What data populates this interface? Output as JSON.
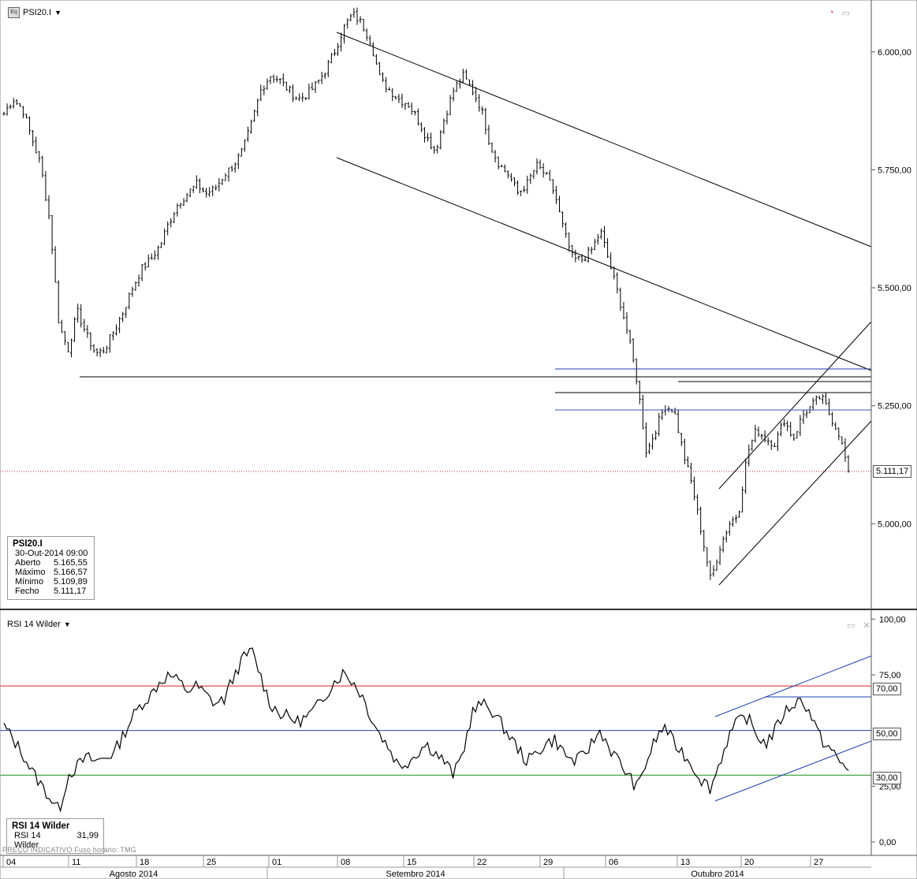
{
  "price_panel": {
    "symbol": "PSI20.I",
    "info": {
      "title": "PSI20.I",
      "datetime": "30-Out-2014 09:00",
      "rows": [
        {
          "label": "Aberto",
          "value": "5.165,55"
        },
        {
          "label": "Máximo",
          "value": "5.166,57"
        },
        {
          "label": "Mínimo",
          "value": "5.109,89"
        },
        {
          "label": "Fecho",
          "value": "5.111,17"
        }
      ]
    },
    "last_price_label": "5.111,17"
  },
  "rsi_panel": {
    "title": "RSI 14 Wilder",
    "info": {
      "title": "RSI 14 Wilder",
      "label": "RSI 14 Wilder",
      "value": "31,99"
    },
    "level_labels": [
      "70,00",
      "50,00",
      "30,00"
    ]
  },
  "footnote": "PREÇO INDICATIVO   Fuso horário: TMG",
  "colors": {
    "bars": "#000000",
    "trendlines": "#000000",
    "blue_lines": "#1f3fae",
    "rsi_line": "#000000",
    "rsi_70": "#e02020",
    "rsi_50": "#2a3fb0",
    "rsi_30": "#1a8a1a",
    "last_price_line": "#c03030",
    "axis_bg": "#ffffff",
    "grid_border": "#888888"
  },
  "chart_data": [
    {
      "type": "ohlc",
      "title": "PSI20.I",
      "y_ticks": [
        "6.000,00",
        "5.750,00",
        "5.500,00",
        "5.250,00",
        "5.000,00"
      ],
      "y_tick_values": [
        6000,
        5750,
        5500,
        5250,
        5000
      ],
      "ylim": [
        4820,
        6110
      ],
      "x_day_ticks": [
        "04",
        "11",
        "18",
        "25",
        "01",
        "08",
        "15",
        "22",
        "29",
        "06",
        "13",
        "20",
        "27"
      ],
      "x_months": [
        "Agosto 2014",
        "Setembro 2014",
        "Outubro 2014"
      ],
      "last_close": 5111.17,
      "closes": [
        5870,
        5900,
        5880,
        5820,
        5760,
        5640,
        5420,
        5370,
        5450,
        5400,
        5360,
        5370,
        5410,
        5450,
        5500,
        5540,
        5560,
        5590,
        5640,
        5680,
        5700,
        5720,
        5700,
        5710,
        5740,
        5760,
        5790,
        5850,
        5920,
        5950,
        5940,
        5920,
        5900,
        5910,
        5930,
        5960,
        6000,
        6050,
        6080,
        6060,
        6020,
        5940,
        5920,
        5900,
        5890,
        5860,
        5820,
        5790,
        5860,
        5920,
        5950,
        5920,
        5880,
        5800,
        5760,
        5740,
        5700,
        5720,
        5760,
        5740,
        5700,
        5620,
        5560,
        5560,
        5580,
        5620,
        5550,
        5480,
        5400,
        5300,
        5150,
        5200,
        5250,
        5240,
        5150,
        5080,
        4980,
        4880,
        4950,
        5000,
        5020,
        5150,
        5200,
        5180,
        5170,
        5220,
        5180,
        5230,
        5250,
        5270,
        5230,
        5190,
        5111
      ]
    },
    {
      "type": "line",
      "title": "RSI 14 Wilder",
      "y_ticks": [
        "100,00",
        "75,00",
        "25,00",
        "0,00"
      ],
      "y_tick_values": [
        100,
        75,
        25,
        0
      ],
      "levels": [
        70,
        50,
        30
      ],
      "ylim": [
        -6,
        104
      ],
      "last_value": 31.99,
      "values": [
        52,
        46,
        40,
        32,
        26,
        20,
        14,
        30,
        34,
        38,
        36,
        38,
        40,
        48,
        56,
        62,
        66,
        72,
        75,
        72,
        68,
        70,
        66,
        62,
        64,
        74,
        82,
        86,
        74,
        62,
        58,
        56,
        54,
        56,
        60,
        66,
        72,
        76,
        72,
        66,
        56,
        48,
        42,
        34,
        36,
        40,
        44,
        40,
        36,
        30,
        40,
        58,
        62,
        60,
        54,
        48,
        42,
        36,
        40,
        44,
        46,
        40,
        36,
        38,
        44,
        50,
        42,
        36,
        30,
        24,
        36,
        46,
        52,
        44,
        40,
        34,
        28,
        24,
        36,
        48,
        54,
        56,
        48,
        44,
        50,
        58,
        62,
        64,
        56,
        46,
        42,
        36,
        32
      ]
    }
  ]
}
